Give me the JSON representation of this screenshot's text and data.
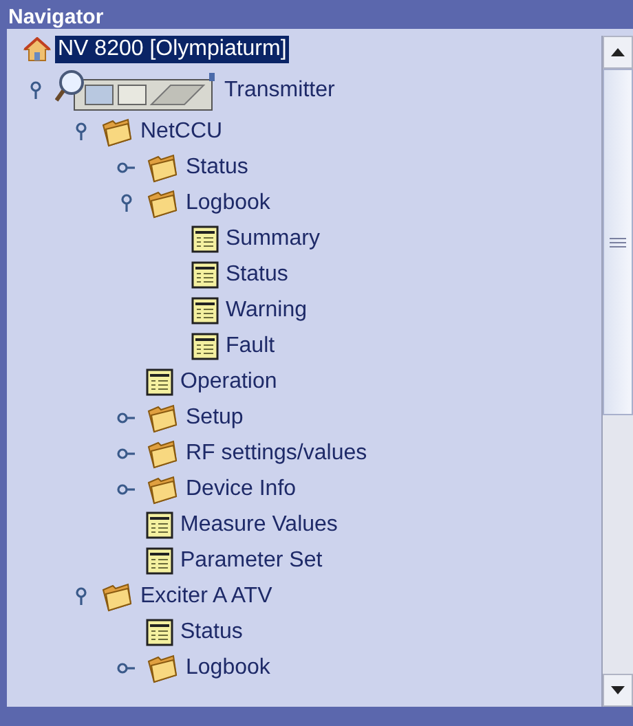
{
  "panel": {
    "title": "Navigator"
  },
  "tree": [
    {
      "label": "NV 8200 [Olympiaturm]",
      "kind": "home",
      "selected": true,
      "children": [
        {
          "label": "Transmitter",
          "kind": "device",
          "selected": false,
          "expanded": true,
          "children": [
            {
              "label": "NetCCU",
              "kind": "folder",
              "selected": false,
              "expanded": true,
              "children": [
                {
                  "label": "Status",
                  "kind": "folder",
                  "selected": false,
                  "expanded": false
                },
                {
                  "label": "Logbook",
                  "kind": "folder",
                  "selected": false,
                  "expanded": true,
                  "children": [
                    {
                      "label": "Summary",
                      "kind": "document",
                      "selected": false
                    },
                    {
                      "label": "Status",
                      "kind": "document",
                      "selected": false
                    },
                    {
                      "label": "Warning",
                      "kind": "document",
                      "selected": false
                    },
                    {
                      "label": "Fault",
                      "kind": "document",
                      "selected": false
                    }
                  ]
                },
                {
                  "label": "Operation",
                  "kind": "document",
                  "selected": false
                },
                {
                  "label": "Setup",
                  "kind": "folder",
                  "selected": false,
                  "expanded": false
                },
                {
                  "label": "RF settings/values",
                  "kind": "folder",
                  "selected": false,
                  "expanded": false
                },
                {
                  "label": "Device Info",
                  "kind": "folder",
                  "selected": false,
                  "expanded": false
                },
                {
                  "label": "Measure Values",
                  "kind": "document",
                  "selected": false
                },
                {
                  "label": "Parameter Set",
                  "kind": "document",
                  "selected": false
                }
              ]
            },
            {
              "label": "Exciter A ATV",
              "kind": "folder",
              "selected": false,
              "expanded": true,
              "children": [
                {
                  "label": "Status",
                  "kind": "document",
                  "selected": false
                },
                {
                  "label": "Logbook",
                  "kind": "folder",
                  "selected": false,
                  "expanded": false
                }
              ]
            }
          ]
        }
      ]
    }
  ]
}
